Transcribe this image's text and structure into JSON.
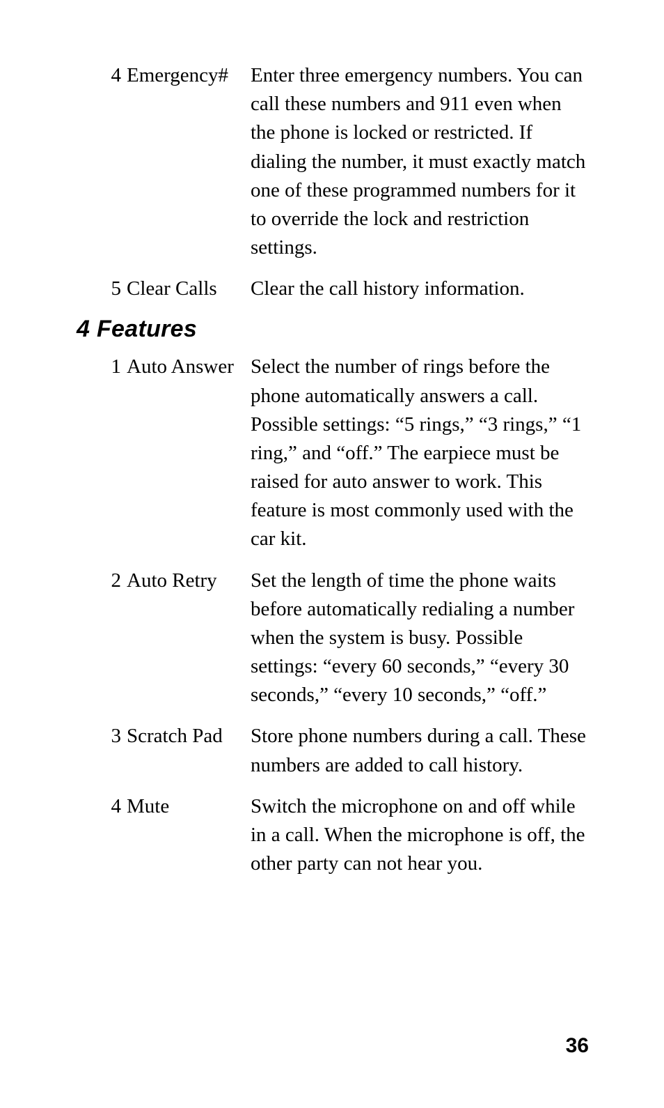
{
  "section1": {
    "items": [
      {
        "num": "4",
        "label": "Emergency#",
        "desc": "Enter three emergency numbers. You can call these numbers and 911 even when the phone is locked or restricted. If dialing the number, it must exactly match one of these programmed numbers for it to override the lock and restriction settings."
      },
      {
        "num": "5",
        "label": "Clear Calls",
        "desc": "Clear the call history information."
      }
    ]
  },
  "heading": "4 Features",
  "section2": {
    "items": [
      {
        "num": "1",
        "label": "Auto Answer",
        "desc": "Select the number of rings before the phone automatically answers a call. Possible settings: “5 rings,” “3 rings,” “1 ring,” and “off.” The earpiece must be raised for auto answer to work. This feature is most commonly used with the car kit."
      },
      {
        "num": "2",
        "label": "Auto Retry",
        "desc": "Set the length of time the phone waits before automatically redialing a number when the system is busy. Possible settings: “every 60 seconds,” “every 30 seconds,” “every 10 seconds,” “off.”"
      },
      {
        "num": "3",
        "label": "Scratch Pad",
        "desc": "Store phone numbers during a call. These numbers are added to call history."
      },
      {
        "num": "4",
        "label": "Mute",
        "desc": "Switch the microphone on and off while in a call. When the microphone is off, the other party can not hear you."
      }
    ]
  },
  "pageNumber": "36"
}
